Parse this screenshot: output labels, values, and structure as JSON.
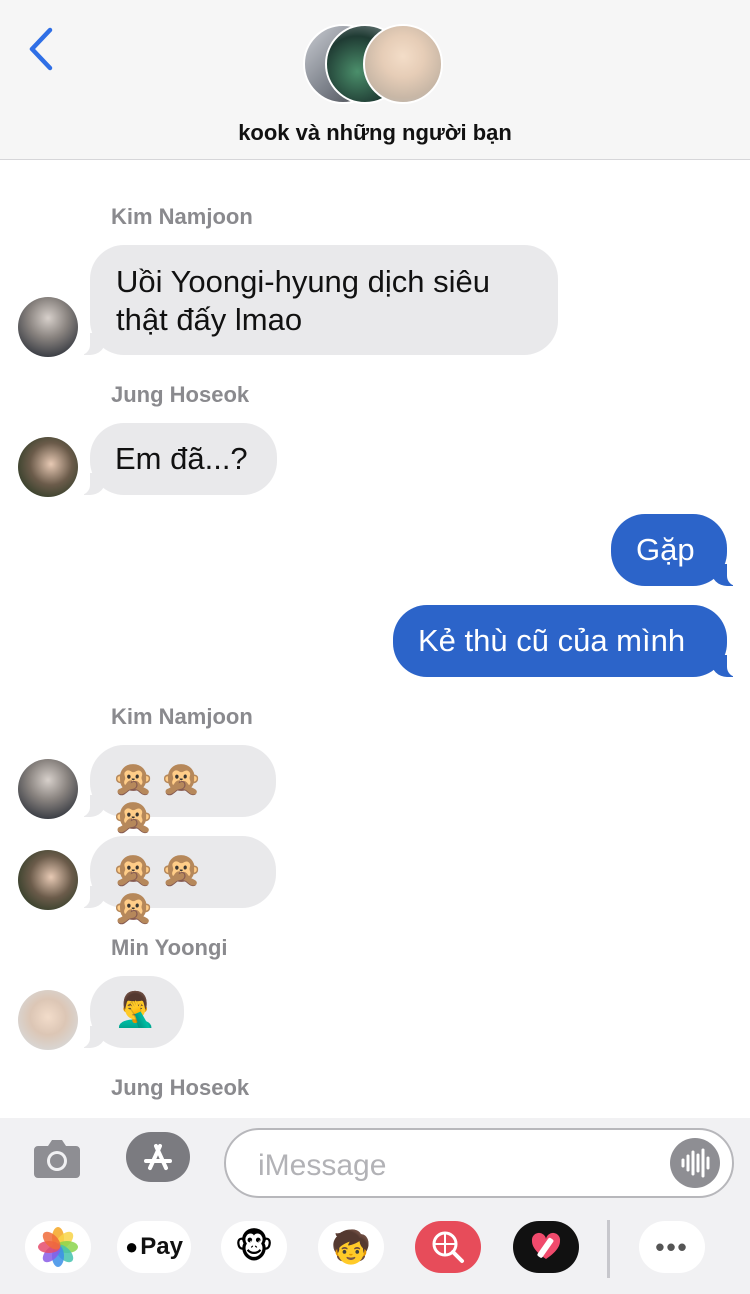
{
  "header": {
    "back_icon": "chevron-left-icon",
    "group_name": "kook và những người bạn"
  },
  "messages": [
    {
      "sender": "Kim Namjoon",
      "text_line1": "Uồi Yoongi-hyung dịch siêu",
      "text_line2": "thật đấy lmao"
    },
    {
      "sender": "Jung Hoseok",
      "text": "Em đã...?"
    },
    {
      "text": "Gặp"
    },
    {
      "text": "Kẻ thù cũ của mình"
    },
    {
      "sender": "Kim Namjoon",
      "text": "🙊🙊🙊"
    },
    {
      "text": "🙊🙊🙊"
    },
    {
      "sender": "Min Yoongi",
      "text": "🤦‍♂️"
    },
    {
      "sender": "Jung Hoseok"
    }
  ],
  "input": {
    "placeholder": "iMessage",
    "camera_icon": "camera-icon",
    "appstore_icon": "app-store-icon",
    "voice_icon": "waveform-icon"
  },
  "apps": {
    "photos_icon": "photos-icon",
    "applepay_label": "Pay",
    "animoji": "🐵",
    "memoji": "🧒",
    "more_label": "•••"
  },
  "colors": {
    "sent_bubble": "#2c64c9",
    "received_bubble": "#e9e9eb",
    "accent": "#2f6fe6"
  }
}
